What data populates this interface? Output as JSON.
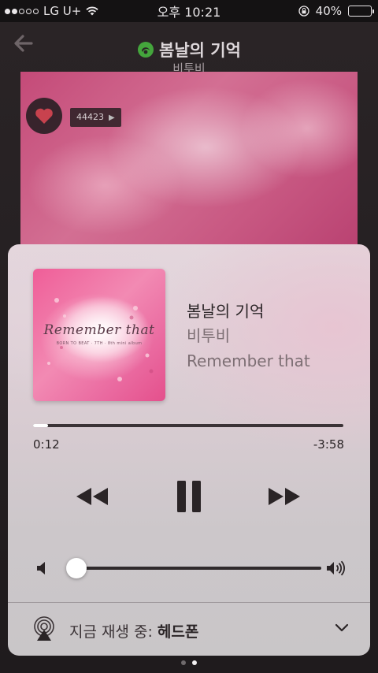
{
  "status_bar": {
    "carrier": "LG U+",
    "time": "오후 10:21",
    "battery": "40%",
    "battery_level": 0.4,
    "signal_bars": 2,
    "signal_total": 5
  },
  "background_player": {
    "song_title": "봄날의 기억",
    "artist": "비투비",
    "like_count": "44423",
    "icons": [
      "back-arrow-icon",
      "app-logo-icon",
      "heart-icon"
    ]
  },
  "now_playing": {
    "album_art_text": "Remember that",
    "album_art_subtext": "BORN TO BEAT · 7TH · 8th mini album",
    "title": "봄날의 기억",
    "artist": "비투비",
    "album": "Remember that",
    "elapsed": "0:12",
    "remaining": "-3:58",
    "progress": 0.048,
    "volume": 0.04,
    "output_prefix": "지금 재생 중: ",
    "output_device": "헤드폰",
    "icons": [
      "rewind-icon",
      "pause-icon",
      "fast-forward-icon",
      "volume-low-icon",
      "volume-high-icon",
      "airplay-icon",
      "chevron-down-icon"
    ]
  },
  "page_indicator": {
    "count": 2,
    "active": 1
  },
  "colors": {
    "accent_pink": "#ef5e98",
    "text_dark": "#2a2426",
    "text_muted": "#7d6f74"
  }
}
